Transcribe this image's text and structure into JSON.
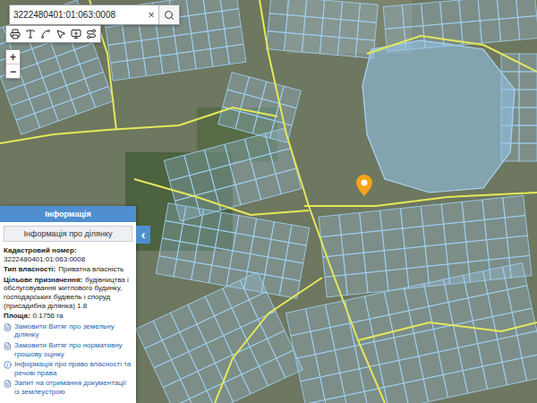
{
  "search": {
    "value": "3222480401:01:063:0008",
    "clear": "×"
  },
  "zoom": {
    "in": "+",
    "out": "−"
  },
  "info_panel": {
    "title": "Інформація",
    "collapse": "‹",
    "subtitle": "Інформація про ділянку",
    "fields": [
      {
        "label": "Кадастровий номер:",
        "value": "3222480401:01:063:0008",
        "kind": "block"
      },
      {
        "label": "Тип власності:",
        "value": "Приватна власність",
        "kind": "inline"
      },
      {
        "label": "Цільове призначення:",
        "value": "будівництва і обслуговування житлового будинку, господарських будівель і споруд (присадибна ділянка) 1.8",
        "kind": "inline"
      },
      {
        "label": "Площа:",
        "value": "0.1756 га",
        "kind": "inline"
      }
    ],
    "links": [
      {
        "label": "Замовити Витяг про земельну ділянку",
        "kind": "document"
      },
      {
        "label": "Замовити Витяг про нормативну грошову оцінку",
        "kind": "document"
      },
      {
        "label": "Інформація про право власності та речові права",
        "kind": "info"
      },
      {
        "label": "Запит на отримання документації із землеустрою",
        "kind": "document"
      }
    ]
  }
}
